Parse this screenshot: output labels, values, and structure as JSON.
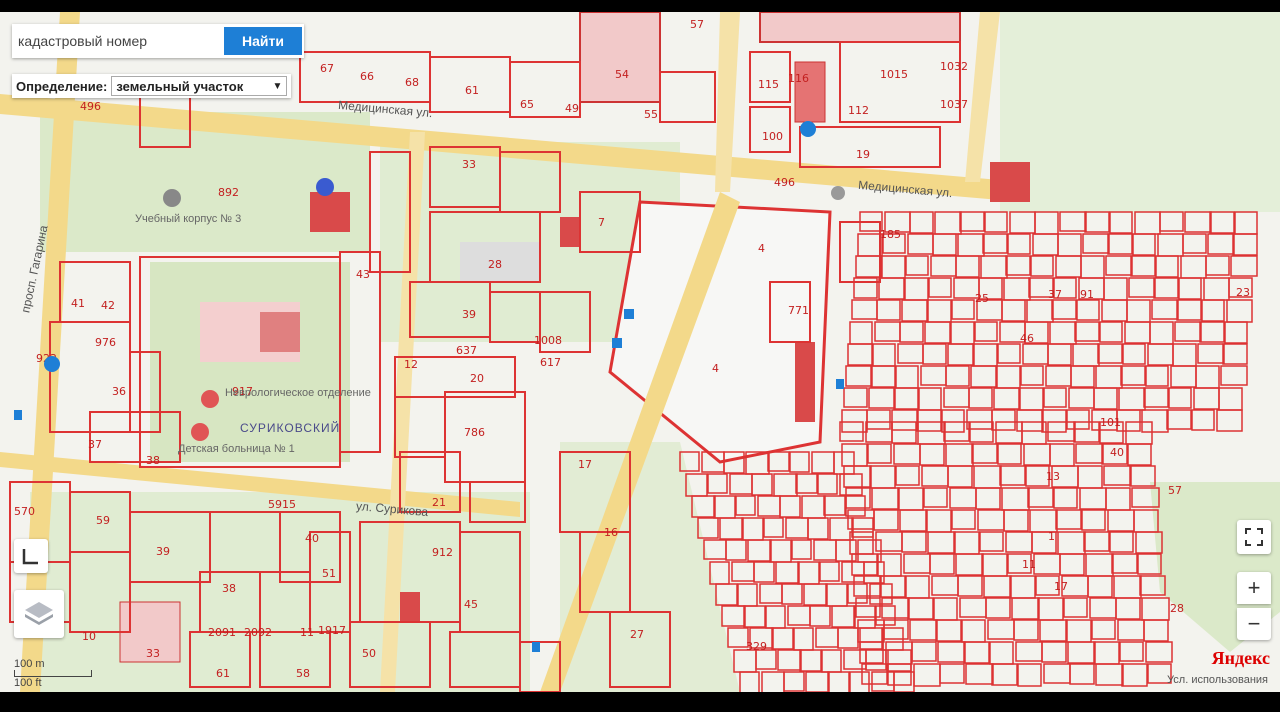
{
  "search": {
    "placeholder": "кадастровый номер",
    "button_label": "Найти"
  },
  "define": {
    "label": "Определение:",
    "selected": "земельный участок"
  },
  "streets": {
    "medicinskaya_1": "Медицинская ул.",
    "medicinskaya_2": "Медицинская ул.",
    "gagarina": "просп. Гагарина",
    "surikova": "ул. Сурикова",
    "district": "СУРИКОВСКИЙ"
  },
  "pois": {
    "campus": "Учебный корпус № 3",
    "neuro": "Неврологическое отделение",
    "children": "Детская больница № 1"
  },
  "parcels": [
    {
      "id": "67",
      "c": "r"
    },
    {
      "id": "66",
      "c": "r"
    },
    {
      "id": "68",
      "c": "r"
    },
    {
      "id": "61",
      "c": "r"
    },
    {
      "id": "65",
      "c": "r"
    },
    {
      "id": "49",
      "c": "r"
    },
    {
      "id": "57",
      "c": "r"
    },
    {
      "id": "54",
      "c": "r"
    },
    {
      "id": "55",
      "c": "r"
    },
    {
      "id": "115",
      "c": "r"
    },
    {
      "id": "116",
      "c": "r"
    },
    {
      "id": "1015",
      "c": "r"
    },
    {
      "id": "1032",
      "c": "r"
    },
    {
      "id": "112",
      "c": "r"
    },
    {
      "id": "1037",
      "c": "r"
    },
    {
      "id": "100",
      "c": "r"
    },
    {
      "id": "19",
      "c": "r"
    },
    {
      "id": "496",
      "c": "r"
    },
    {
      "id": "496",
      "c": "r"
    },
    {
      "id": "892",
      "c": "r"
    },
    {
      "id": "33",
      "c": "r"
    },
    {
      "id": "28",
      "c": "r"
    },
    {
      "id": "7",
      "c": "r"
    },
    {
      "id": "4",
      "c": "r"
    },
    {
      "id": "4",
      "c": "r"
    },
    {
      "id": "771",
      "c": "r"
    },
    {
      "id": "43",
      "c": "r"
    },
    {
      "id": "39",
      "c": "r"
    },
    {
      "id": "41",
      "c": "r"
    },
    {
      "id": "42",
      "c": "r"
    },
    {
      "id": "976",
      "c": "r"
    },
    {
      "id": "922",
      "c": "r"
    },
    {
      "id": "36",
      "c": "r"
    },
    {
      "id": "37",
      "c": "r"
    },
    {
      "id": "38",
      "c": "r"
    },
    {
      "id": "917",
      "c": "r"
    },
    {
      "id": "637",
      "c": "r"
    },
    {
      "id": "617",
      "c": "r"
    },
    {
      "id": "1008",
      "c": "r"
    },
    {
      "id": "12",
      "c": "r"
    },
    {
      "id": "20",
      "c": "r"
    },
    {
      "id": "786",
      "c": "r"
    },
    {
      "id": "21",
      "c": "r"
    },
    {
      "id": "17",
      "c": "r"
    },
    {
      "id": "16",
      "c": "r"
    },
    {
      "id": "5915",
      "c": "r"
    },
    {
      "id": "912",
      "c": "r"
    },
    {
      "id": "570",
      "c": "r"
    },
    {
      "id": "59",
      "c": "r"
    },
    {
      "id": "39",
      "c": "r"
    },
    {
      "id": "40",
      "c": "r"
    },
    {
      "id": "51",
      "c": "r"
    },
    {
      "id": "38",
      "c": "r"
    },
    {
      "id": "50",
      "c": "r"
    },
    {
      "id": "10",
      "c": "r"
    },
    {
      "id": "33",
      "c": "r"
    },
    {
      "id": "2091",
      "c": "r"
    },
    {
      "id": "2092",
      "c": "r"
    },
    {
      "id": "61",
      "c": "r"
    },
    {
      "id": "1917",
      "c": "r"
    },
    {
      "id": "58",
      "c": "r"
    },
    {
      "id": "11",
      "c": "r"
    },
    {
      "id": "45",
      "c": "r"
    },
    {
      "id": "27",
      "c": "r"
    },
    {
      "id": "329",
      "c": "r"
    },
    {
      "id": "185",
      "c": "r"
    },
    {
      "id": "101",
      "c": "r"
    },
    {
      "id": "57",
      "c": "r"
    },
    {
      "id": "23",
      "c": "r"
    },
    {
      "id": "25",
      "c": "r"
    },
    {
      "id": "37",
      "c": "r"
    },
    {
      "id": "91",
      "c": "r"
    },
    {
      "id": "46",
      "c": "r"
    },
    {
      "id": "13",
      "c": "r"
    },
    {
      "id": "40",
      "c": "r"
    },
    {
      "id": "17",
      "c": "r"
    },
    {
      "id": "28",
      "c": "r"
    },
    {
      "id": "11",
      "c": "r"
    },
    {
      "id": "1",
      "c": "r"
    }
  ],
  "controls": {
    "zoom_in": "+",
    "zoom_out": "−",
    "fullscreen": "⛶",
    "ruler": "📐"
  },
  "scale": {
    "top": "100 m",
    "bottom": "100 ft"
  },
  "brand": "Яндекс",
  "copyright": "Усл. использования"
}
